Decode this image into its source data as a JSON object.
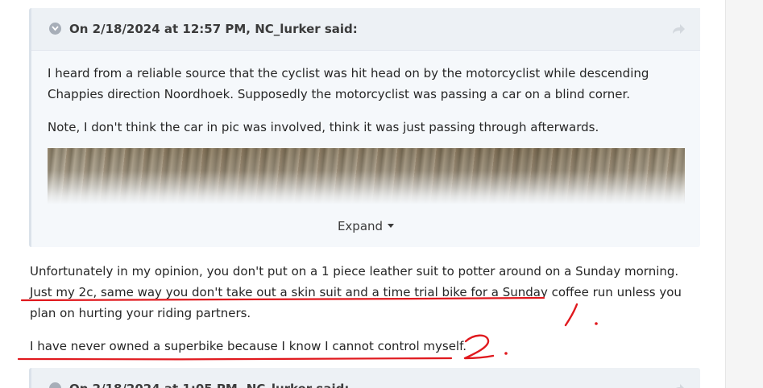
{
  "quote1": {
    "attribution": "On 2/18/2024 at 12:57 PM, NC_lurker said:",
    "paragraphs": [
      "I heard from a reliable source that the cyclist was hit head on by the motorcyclist while descending Chappies direction Noordhoek. Supposedly the motorcyclist was passing a car on a blind corner.",
      "Note, I don't think the car in pic was involved, think it was just passing through afterwards."
    ],
    "expand_label": "Expand"
  },
  "post": {
    "paragraphs": [
      "Unfortunately in my opinion, you don't put on a 1 piece leather suit to potter around on a Sunday morning. Just my 2c, same way you don't take out a skin suit and a time trial bike for a Sunday coffee run unless you plan on hurting your riding partners.",
      "I have never owned a superbike because I know I cannot control myself."
    ]
  },
  "annotations": {
    "mark1": "1.",
    "mark2": "2.",
    "color": "#e0191e"
  },
  "quote2": {
    "attribution": "On 2/18/2024 at 1:05 PM, NC_lurker said:"
  },
  "colors": {
    "quote_bg": "#f5f8fb",
    "quote_header_bg": "#edf1f5",
    "text": "#262626"
  }
}
